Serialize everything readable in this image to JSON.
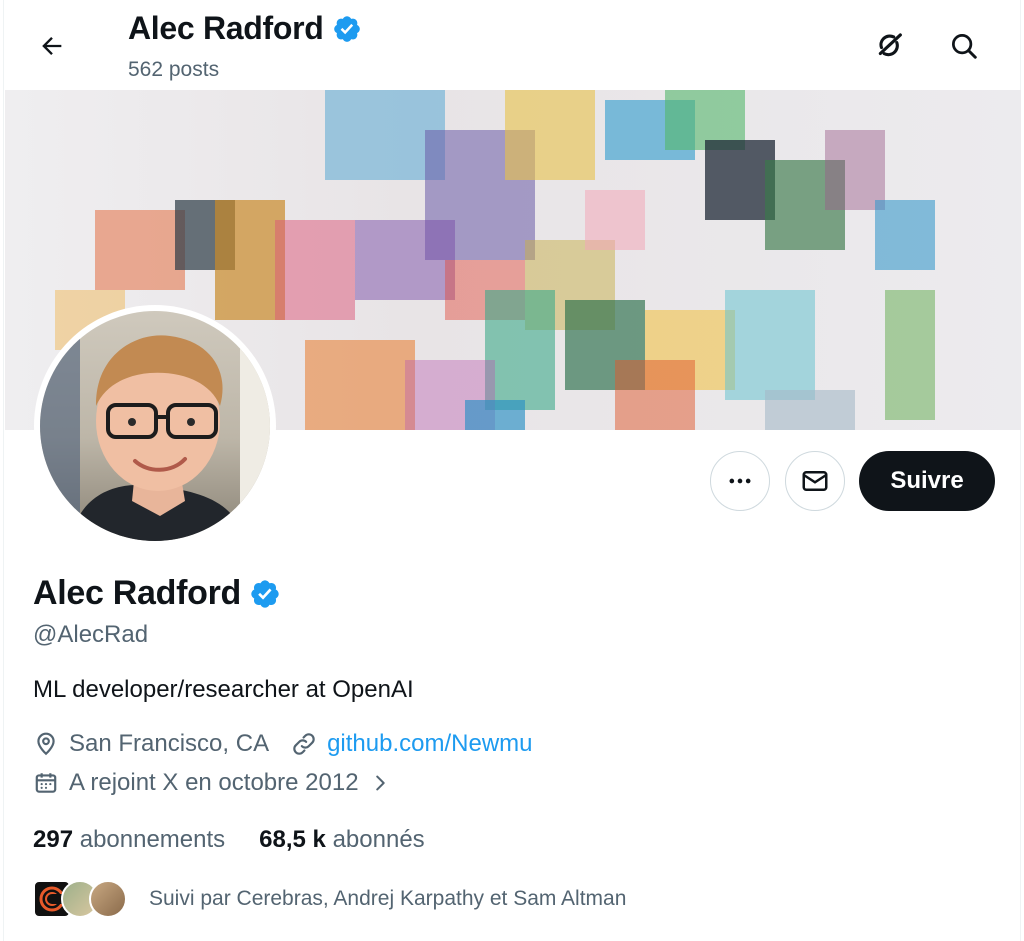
{
  "header": {
    "name": "Alec Radford",
    "posts": "562 posts"
  },
  "profile": {
    "name": "Alec Radford",
    "handle": "@AlecRad",
    "bio": "ML developer/researcher at OpenAI",
    "location": "San Francisco, CA",
    "website": "github.com/Newmu",
    "joined": "A rejoint X en octobre 2012",
    "following_count": "297",
    "following_label": "abonnements",
    "followers_count": "68,5 k",
    "followers_label": "abonnés",
    "followed_by": "Suivi par Cerebras, Andrej Karpathy et Sam Altman"
  },
  "actions": {
    "follow_label": "Suivre"
  },
  "colors": {
    "verified": "#1d9bf0",
    "link": "#1d9bf0",
    "primary_text": "#0f1419",
    "secondary_text": "#536471",
    "follow_button_bg": "#0f1419"
  },
  "icons": {
    "back": "arrow-left-icon",
    "grok": "grok-icon",
    "search": "search-icon",
    "more": "more-dots-icon",
    "message": "envelope-icon",
    "location": "location-pin-icon",
    "link": "link-icon",
    "calendar": "calendar-icon",
    "verified": "verified-badge-icon"
  }
}
